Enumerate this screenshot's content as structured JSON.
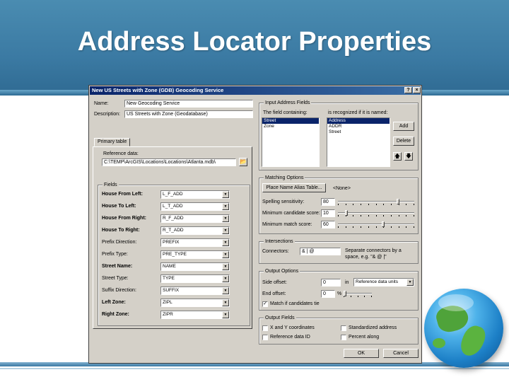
{
  "slide": {
    "title": "Address Locator Properties"
  },
  "dialog": {
    "title": "New US Streets with Zone (GDB) Geocoding Service",
    "help_btn": "?",
    "close_btn": "×",
    "name_label": "Name:",
    "name_value": "New Geocoding Service",
    "description_label": "Description:",
    "description_value": "US Streets with Zone (Geodatabase)",
    "primary_tab": "Primary table",
    "reference_data_label": "Reference data:",
    "reference_data_value": "C:\\TEMP\\ArcGIS\\Locations\\Locations\\Atlanta.mdb\\",
    "fields": {
      "title": "Fields",
      "rows": [
        {
          "label": "House From Left:",
          "value": "L_F_ADD"
        },
        {
          "label": "House To Left:",
          "value": "L_T_ADD"
        },
        {
          "label": "House From Right:",
          "value": "R_F_ADD"
        },
        {
          "label": "House To Right:",
          "value": "R_T_ADD"
        },
        {
          "label": "Prefix Direction:",
          "value": "PREFIX"
        },
        {
          "label": "Prefix Type:",
          "value": "PRE_TYPE"
        },
        {
          "label": "Street Name:",
          "value": "NAME"
        },
        {
          "label": "Street Type:",
          "value": "TYPE"
        },
        {
          "label": "Suffix Direction:",
          "value": "SUFFIX"
        },
        {
          "label": "Left Zone:",
          "value": "ZIPL"
        },
        {
          "label": "Right Zone:",
          "value": "ZIPR"
        }
      ]
    },
    "input_fields": {
      "title": "Input Address Fields",
      "col1_label": "The field containing:",
      "col2_label": "is recognized if it is named:",
      "col1_items": [
        "Street",
        "Zone"
      ],
      "col2_items": [
        "Address",
        "ADDR",
        "Street"
      ],
      "add_btn": "Add",
      "delete_btn": "Delete"
    },
    "matching": {
      "title": "Matching Options",
      "place_alias_btn": "Place Name Alias Table...",
      "place_alias_value": "<None>",
      "spelling_label": "Spelling sensitivity:",
      "spelling_value": "80",
      "min_candidate_label": "Minimum candidate score:",
      "min_candidate_value": "10",
      "min_match_label": "Minimum match score:",
      "min_match_value": "60",
      "spelling_level": 0.8,
      "min_candidate_level": 0.1,
      "min_match_level": 0.6
    },
    "intersections": {
      "title": "Intersections",
      "connectors_label": "Connectors:",
      "connectors_value": "& | @",
      "connectors_note_1": "Separate connectors by a",
      "connectors_note_2": "space, e.g. \"& @ |\""
    },
    "output_options": {
      "title": "Output Options",
      "side_offset_label": "Side offset:",
      "side_offset_value": "0",
      "side_offset_unit_prefix": "in",
      "side_offset_units": "Reference data units",
      "end_offset_label": "End offset:",
      "end_offset_value": "0",
      "end_offset_unit": "%",
      "match_candidates_label": "Match if candidates tie",
      "match_candidates_checked": true
    },
    "output_fields": {
      "title": "Output Fields",
      "xy_label": "X and Y coordinates",
      "standardized_label": "Standardized address",
      "refid_label": "Reference data ID",
      "percent_along_label": "Percent along"
    },
    "ok_btn": "OK",
    "cancel_btn": "Cancel"
  },
  "colors": {
    "header_blue": "#3b7aa3",
    "dialog_face": "#d4d0c8",
    "titlebar": "#0a246a",
    "selection": "#0a246a"
  }
}
